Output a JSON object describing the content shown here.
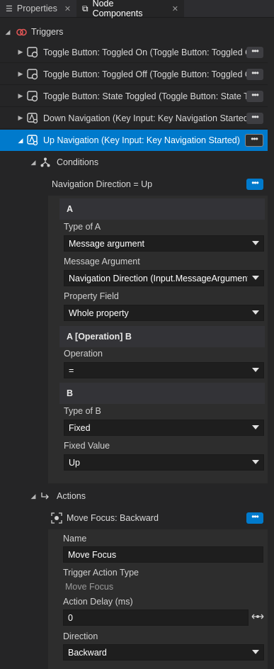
{
  "tabs": [
    {
      "label": "Properties",
      "icon": "list-icon"
    },
    {
      "label": "Node Components",
      "icon": "component-icon"
    }
  ],
  "triggers": {
    "header": "Triggers",
    "items": [
      {
        "label": "Toggle Button: Toggled On (Toggle Button: Toggled On)"
      },
      {
        "label": "Toggle Button: Toggled Off (Toggle Button: Toggled Off)"
      },
      {
        "label": "Toggle Button: State Toggled (Toggle Button: State Toggled)"
      },
      {
        "label": "Down Navigation (Key Input: Key Navigation Started)"
      },
      {
        "label": "Up Navigation (Key Input: Key Navigation Started)"
      }
    ]
  },
  "conditions": {
    "header": "Conditions",
    "condition_title": "Navigation Direction = Up",
    "section_a": "A",
    "type_of_a_label": "Type of A",
    "type_of_a_value": "Message argument",
    "message_argument_label": "Message Argument",
    "message_argument_value": "Navigation Direction (Input.MessageArgument.NavigationDirection)",
    "property_field_label": "Property Field",
    "property_field_value": "Whole property",
    "section_op": "A [Operation] B",
    "operation_label": "Operation",
    "operation_value": "=",
    "section_b": "B",
    "type_of_b_label": "Type of B",
    "type_of_b_value": "Fixed",
    "fixed_value_label": "Fixed Value",
    "fixed_value_value": "Up"
  },
  "actions": {
    "header": "Actions",
    "action_title": "Move Focus: Backward",
    "name_label": "Name",
    "name_value": "Move Focus",
    "trigger_action_type_label": "Trigger Action Type",
    "trigger_action_type_value": "Move Focus",
    "action_delay_label": "Action Delay (ms)",
    "action_delay_value": "0",
    "direction_label": "Direction",
    "direction_value": "Backward"
  },
  "more_button": "•••",
  "colors": {
    "accent": "#007acc",
    "background": "#252526"
  }
}
